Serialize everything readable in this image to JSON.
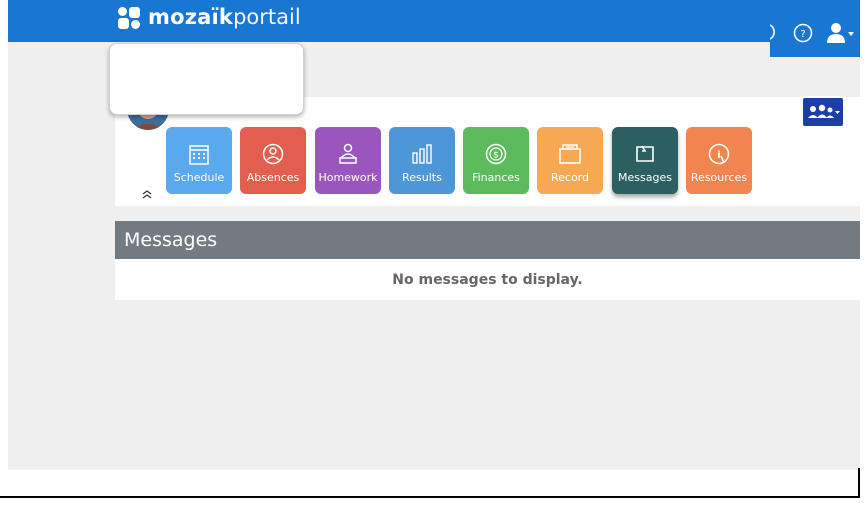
{
  "brand": {
    "name_bold": "mozaïk",
    "name_light": "portail"
  },
  "header": {
    "help_icon": "question-circle-icon",
    "user_icon": "user-menu-icon"
  },
  "family_button": {
    "icon": "family-icon"
  },
  "tiles": [
    {
      "label": "Schedule",
      "color": "#5aa9ee",
      "icon": "calendar-icon"
    },
    {
      "label": "Absences",
      "color": "#e25e4e",
      "icon": "absence-icon"
    },
    {
      "label": "Homework",
      "color": "#9b56bd",
      "icon": "homework-icon"
    },
    {
      "label": "Results",
      "color": "#4d97d9",
      "icon": "bar-chart-icon"
    },
    {
      "label": "Finances",
      "color": "#5cbb5c",
      "icon": "dollar-icon"
    },
    {
      "label": "Record",
      "color": "#f6a952",
      "icon": "folder-icon"
    },
    {
      "label": "Messages",
      "color": "#2b5f60",
      "icon": "message-icon",
      "active": true
    },
    {
      "label": "Resources",
      "color": "#f28450",
      "icon": "resources-icon"
    }
  ],
  "collapse_label": "ˆ",
  "messages": {
    "title": "Messages",
    "empty_text": "No messages to display."
  }
}
